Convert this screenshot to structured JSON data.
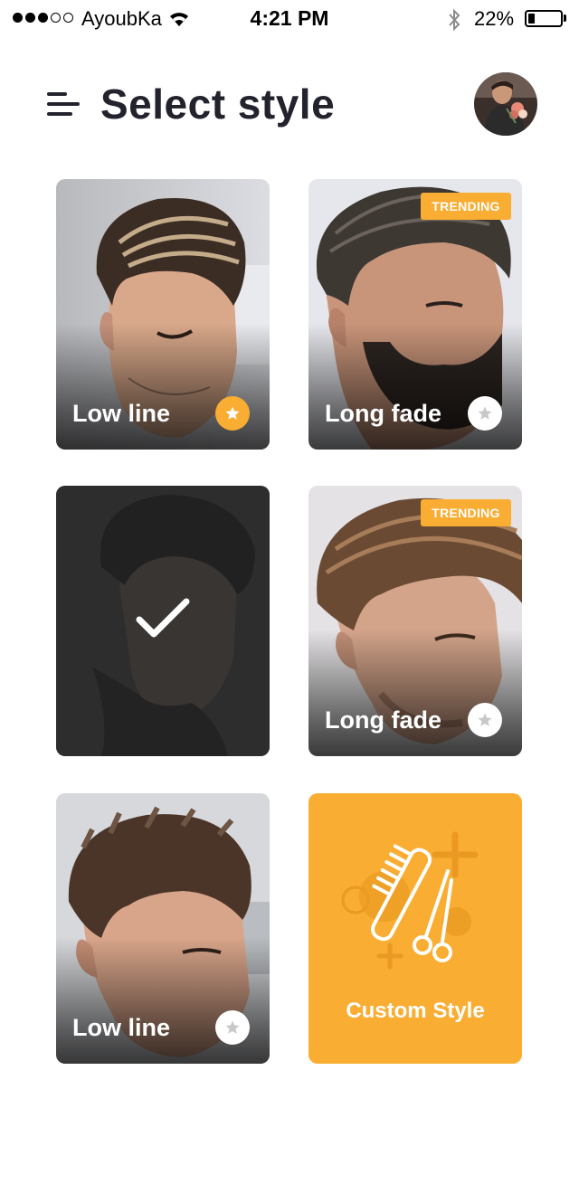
{
  "status_bar": {
    "carrier": "AyoubKa",
    "time": "4:21 PM",
    "battery_percent": "22%",
    "battery_level": 0.22,
    "signal_bars_filled": 3,
    "signal_bars_total": 5
  },
  "header": {
    "title": "Select style",
    "menu_icon": "hamburger-menu-icon",
    "avatar": "user-avatar"
  },
  "colors": {
    "accent": "#f9ad32",
    "text_dark": "#23232e",
    "selected_overlay": "#232323"
  },
  "styles": [
    {
      "label": "Low line",
      "favorite": true,
      "trending": false,
      "selected": false
    },
    {
      "label": "Long fade",
      "favorite": false,
      "trending": true,
      "trending_label": "TRENDING",
      "selected": false
    },
    {
      "label": "",
      "favorite": false,
      "trending": false,
      "selected": true,
      "selected_icon": "checkmark-icon"
    },
    {
      "label": "Long fade",
      "favorite": false,
      "trending": true,
      "trending_label": "TRENDING",
      "selected": false
    },
    {
      "label": "Low line",
      "favorite": false,
      "trending": false,
      "selected": false
    }
  ],
  "custom_style": {
    "label": "Custom Style",
    "icon": "comb-and-scissors-icon"
  }
}
